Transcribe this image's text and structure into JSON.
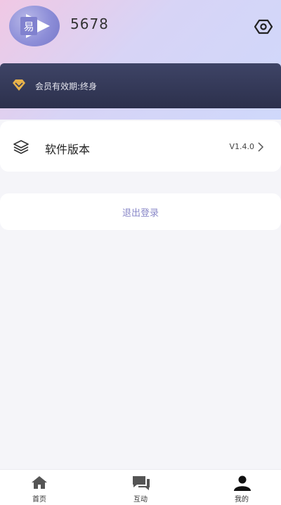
{
  "header": {
    "username": "5678",
    "avatar_glyph": "易",
    "icons": {
      "avatar": "play-logo-icon",
      "settings": "settings-icon"
    }
  },
  "membership": {
    "text": "会员有效期:终身",
    "icon": "diamond-icon",
    "accent_color": "#e8b24a"
  },
  "menu": {
    "version_label": "软件版本",
    "version_value": "V1.4.0",
    "icon": "layers-icon"
  },
  "logout": {
    "label": "退出登录",
    "color": "#8a88c8"
  },
  "tabbar": {
    "items": [
      {
        "label": "首页",
        "icon": "home-icon"
      },
      {
        "label": "互动",
        "icon": "chat-icon"
      },
      {
        "label": "我的",
        "icon": "user-icon",
        "active": true
      }
    ]
  },
  "colors": {
    "header_gradient_start": "#f0c8e4",
    "header_gradient_end": "#cfd8fb",
    "member_bar": "#2c304c",
    "page_bg": "#f5f5f9"
  }
}
